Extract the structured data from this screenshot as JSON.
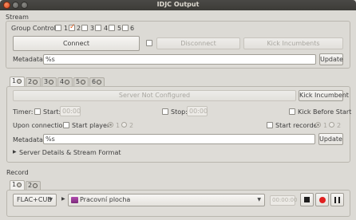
{
  "window": {
    "title": "IDJC Output"
  },
  "stream": {
    "section_label": "Stream",
    "group_controls_label": "Group Controls",
    "groups": [
      {
        "label": "1",
        "checked": false
      },
      {
        "label": "2",
        "checked": true
      },
      {
        "label": "3",
        "checked": false
      },
      {
        "label": "4",
        "checked": false
      },
      {
        "label": "5",
        "checked": false
      },
      {
        "label": "6",
        "checked": false
      }
    ],
    "connect_label": "Connect",
    "disconnect_label": "Disconnect",
    "kick_incumbents_label": "Kick Incumbents",
    "metadata_label": "Metadata:",
    "metadata_value": "%s",
    "update_label": "Update"
  },
  "server_tabs": [
    {
      "label": "1"
    },
    {
      "label": "2"
    },
    {
      "label": "3"
    },
    {
      "label": "4"
    },
    {
      "label": "5"
    },
    {
      "label": "6"
    }
  ],
  "server": {
    "status": "Server Not Configured",
    "kick_incumbent_label": "Kick Incumbent",
    "timer_label": "Timer:",
    "start_label": "Start:",
    "start_time": "00:00",
    "stop_label": "Stop:",
    "stop_time": "00:00",
    "kick_before_start_label": "Kick Before Start",
    "upon_connection_label": "Upon connection:",
    "start_player_label": "Start player",
    "start_recorder_label": "Start recorder",
    "player_options": [
      "1",
      "2"
    ],
    "recorder_options": [
      "1",
      "2"
    ],
    "metadata_label": "Metadata:",
    "metadata_value": "%s",
    "update_label": "Update",
    "details_label": "Server Details & Stream Format"
  },
  "record": {
    "section_label": "Record",
    "tabs": [
      {
        "label": "1"
      },
      {
        "label": "2"
      }
    ],
    "format_value": "FLAC+CUE",
    "folder_value": "Pracovní plocha",
    "time_value": "00:00:00"
  },
  "colors": {
    "accent": "#e05a1a",
    "titlebar": "#3c3b37",
    "record_dot": "#e02020"
  }
}
